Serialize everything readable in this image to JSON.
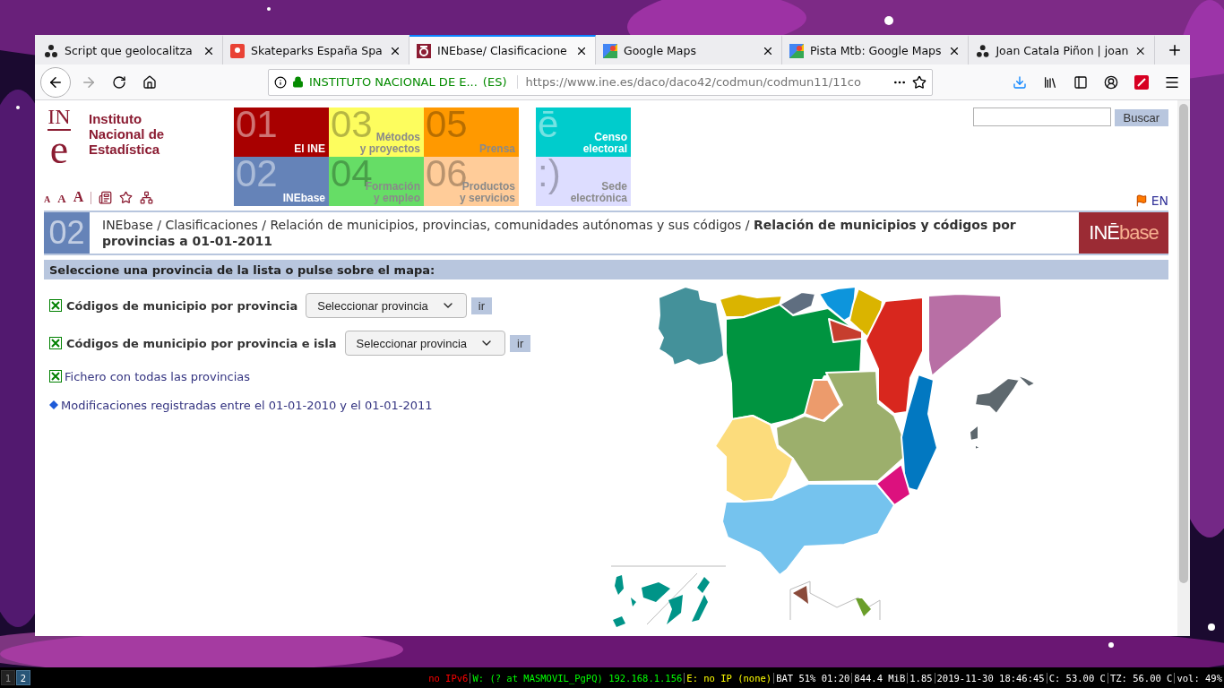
{
  "tabs": [
    {
      "title": "Script que geolocalitza",
      "kind": "dots",
      "selected": false
    },
    {
      "title": "Skateparks España Spa",
      "kind": "pin",
      "selected": false
    },
    {
      "title": "INEbase/ Clasificacione",
      "kind": "ine",
      "selected": true
    },
    {
      "title": "Google Maps",
      "kind": "maps",
      "selected": false
    },
    {
      "title": "Pista Mtb: Google Maps",
      "kind": "maps",
      "selected": false
    },
    {
      "title": "Joan Catala Piñon | joan",
      "kind": "dots",
      "selected": false
    }
  ],
  "address_bar": {
    "site_identity": "INSTITUTO NACIONAL DE E...",
    "country": "(ES)",
    "url": "https://www.ine.es/daco/daco42/codmun/codmun11/11co"
  },
  "site": {
    "logo": {
      "top": "IN",
      "bottom": "e",
      "name": "Instituto\nNacional de\nEstadística"
    },
    "font_size_controls": [
      "A",
      "A",
      "A"
    ],
    "nav_tiles": [
      {
        "number": "01",
        "label": "El INE",
        "color": "#a80000",
        "kind": "dark"
      },
      {
        "number": "03",
        "label": "Métodos\ny proyectos",
        "color": "#fdfd5e",
        "kind": "light"
      },
      {
        "number": "05",
        "label": "Prensa",
        "color": "#ff9900",
        "kind": "light"
      },
      {
        "number": "ē",
        "label": "Censo\nelectoral",
        "color": "#00cccc",
        "kind": "dark"
      },
      {
        "number": "02",
        "label": "INEbase",
        "color": "#6583b8",
        "kind": "dark"
      },
      {
        "number": "04",
        "label": "Formación\ny empleo",
        "color": "#66dd66",
        "kind": "light"
      },
      {
        "number": "06",
        "label": "Productos\ny servicios",
        "color": "#ffcc99",
        "kind": "light"
      },
      {
        "number": ":)",
        "label": "Sede\nelectrónica",
        "color": "#ddddff",
        "kind": "light"
      }
    ],
    "search_button": "Buscar",
    "language": "EN",
    "breadcrumb": {
      "section_number": "02",
      "text": "INEbase / Clasificaciones / Relación de municipios, provincias, comunidades autónomas y sus códigos / **Relación de municipios y códigos por provincias a 01-01-2011**",
      "product_logo_a": "INĒ",
      "product_logo_b": "base"
    },
    "prompt": "Seleccione una provincia de la lista o pulse sobre el mapa:",
    "downloads": [
      {
        "kind": "select",
        "label": "Códigos de municipio por provincia",
        "select": "Seleccionar provincia",
        "button": "ir"
      },
      {
        "kind": "select",
        "label": "Códigos de municipio por provincia e isla",
        "select": "Seleccionar provincia",
        "button": "ir"
      },
      {
        "kind": "link",
        "label": "Fichero con todas las provincias"
      }
    ],
    "modifications_link": "Modificaciones registradas entre el 01-01-2010 y el 01-01-2011"
  },
  "status_bar": {
    "workspaces": [
      {
        "label": "1",
        "selected": false
      },
      {
        "label": "2",
        "selected": true
      }
    ],
    "items": [
      {
        "text": "no IPv6",
        "color": "#ff0000"
      },
      {
        "text": "W: (? at MASMOVIL_PgPQ) 192.168.1.156",
        "color": "#00ff00"
      },
      {
        "text": "E: no IP (none)",
        "color": "#ffff00"
      },
      {
        "text": "BAT 51% 01:20",
        "color": "#ffffff"
      },
      {
        "text": "844.4 MiB",
        "color": "#ffffff"
      },
      {
        "text": "1.85",
        "color": "#ffffff"
      },
      {
        "text": "2019-11-30 18:46:45",
        "color": "#ffffff"
      },
      {
        "text": "C: 53.00 C",
        "color": "#ffffff"
      },
      {
        "text": "TZ: 56.00 C",
        "color": "#ffffff"
      },
      {
        "text": "vol: 49%",
        "color": "#ffffff"
      }
    ]
  }
}
